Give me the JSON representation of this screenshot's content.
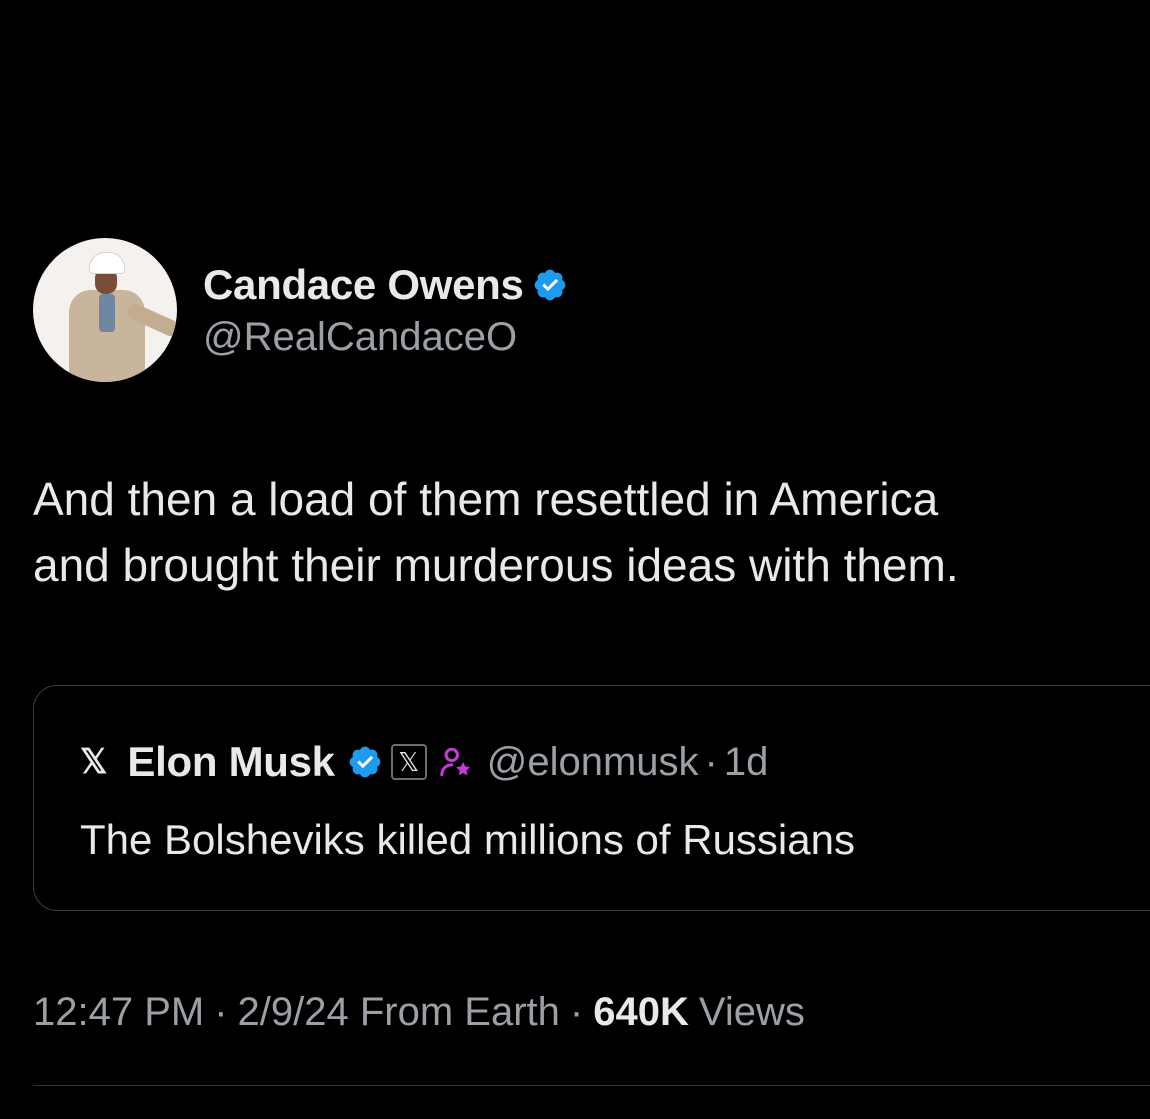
{
  "author": {
    "display_name": "Candace Owens",
    "handle": "@RealCandaceO"
  },
  "tweet": {
    "text_line_1": "And then a load of them resettled in America",
    "text_line_2": "and brought their murderous ideas with them."
  },
  "quoted_tweet": {
    "platform_glyph": "𝕏",
    "display_name": "Elon Musk",
    "badge_glyph": "𝕏",
    "handle": "@elonmusk",
    "separator": "·",
    "age": "1d",
    "text": "The Bolsheviks killed millions of Russians"
  },
  "meta": {
    "time": "12:47 PM",
    "separator": "·",
    "date_source": "2/9/24 From Earth",
    "views_count": "640K",
    "views_label": "Views"
  },
  "colors": {
    "background": "#000000",
    "primary_text": "#e7e9ea",
    "secondary_text": "#9aa0a6",
    "verified_blue": "#1d9bf0",
    "affiliation_purple": "#c23bd4",
    "border": "#3a3d41"
  },
  "icons": {
    "verified": "verified-badge-icon",
    "x_logo": "x-logo-icon",
    "affiliation": "affiliate-person-star-icon"
  }
}
